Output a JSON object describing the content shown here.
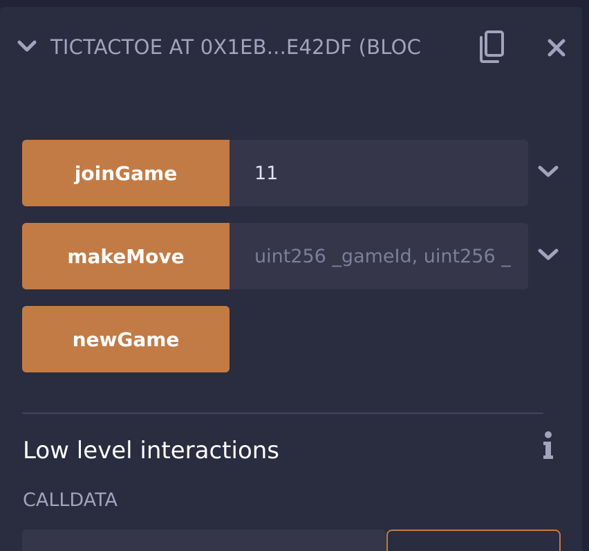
{
  "header": {
    "title": "TICTACTOE AT 0X1EB...E42DF (BLOC",
    "collapse_icon": "chevron-down-icon",
    "copy_icon": "copy-icon",
    "close_icon": "close-icon"
  },
  "functions": [
    {
      "label": "joinGame",
      "value": "11",
      "placeholder": ""
    },
    {
      "label": "makeMove",
      "value": "",
      "placeholder": "uint256 _gameId, uint256 _"
    },
    {
      "label": "newGame"
    }
  ],
  "low_level": {
    "title": "Low level interactions",
    "calldata_label": "CALLDATA",
    "info_icon": "info-icon"
  },
  "colors": {
    "background": "#222336",
    "panel": "#2a2c3f",
    "button": "#c27b45",
    "input": "#35364a",
    "muted_text": "#a2a3bd"
  }
}
